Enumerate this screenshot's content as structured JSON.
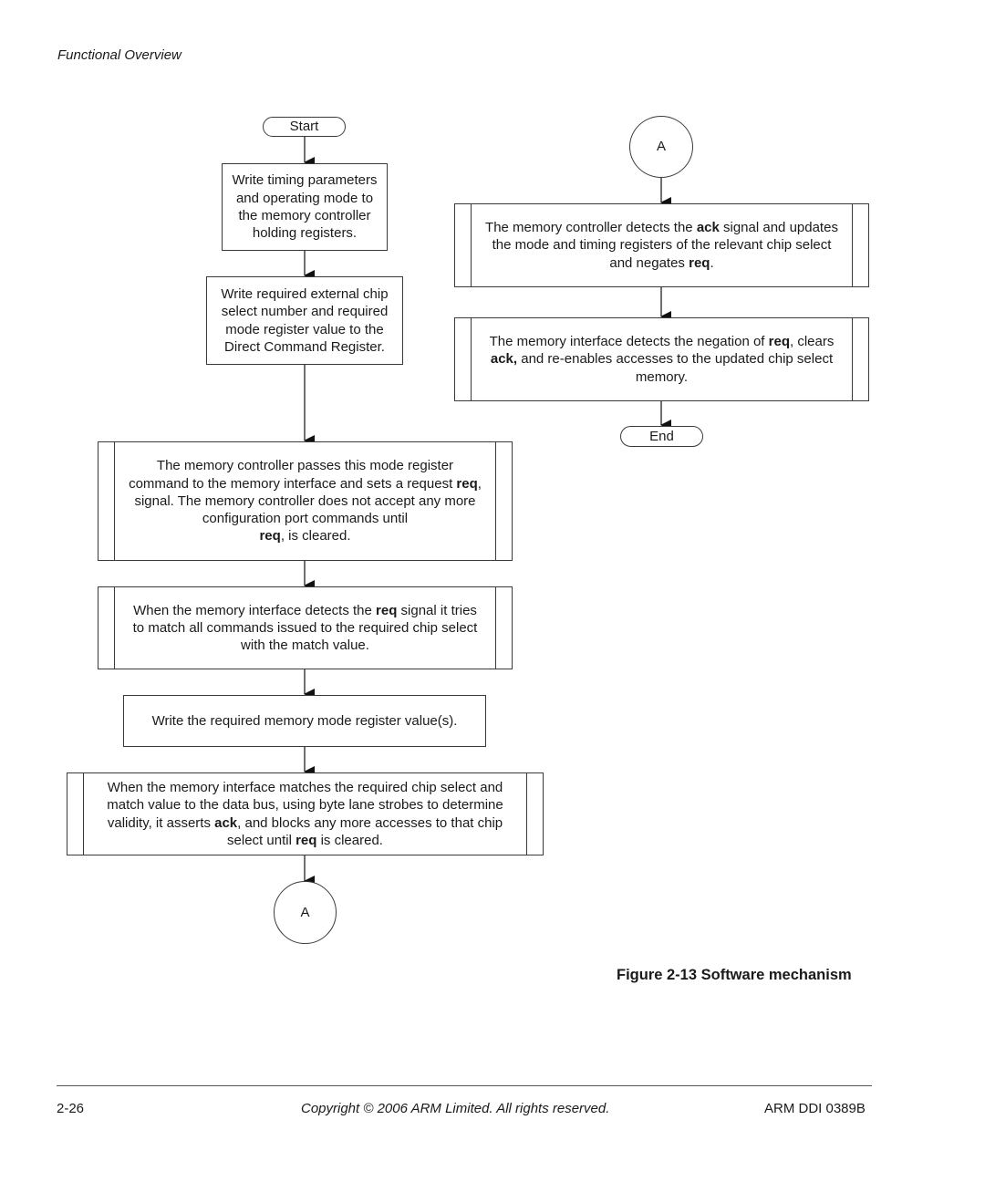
{
  "header": {
    "section": "Functional Overview"
  },
  "flowchart": {
    "start": "Start",
    "end": "End",
    "connector": "A",
    "left_steps": [
      {
        "id": "s1",
        "html": "Write timing parameters<br>and operating mode to<br>the memory controller<br>holding registers."
      },
      {
        "id": "s2",
        "html": "Write required external chip<br>select number and required<br>mode register value to the<br>Direct Command Register."
      },
      {
        "id": "s3",
        "html": "The memory controller passes this mode register<br>command to the memory interface and sets a request <b>req</b>,<br>signal. The memory controller does not accept any more<br>configuration port commands until<br><b>req</b>, is cleared."
      },
      {
        "id": "s4",
        "html": "When the memory interface detects the <b>req</b> signal it tries<br>to match all commands issued to the required chip select<br>with the match value."
      },
      {
        "id": "s5",
        "html": "Write the required memory mode register value(s)."
      },
      {
        "id": "s6",
        "html": "When the memory interface matches the required chip select and<br>match value to the data bus, using byte lane strobes to determine<br>validity, it asserts <b>ack</b>, and blocks any more accesses to that chip<br>select until <b>req</b> is cleared."
      }
    ],
    "right_steps": [
      {
        "id": "r1",
        "html": "The memory controller detects the <b>ack</b> signal and updates<br>the mode and timing registers of the relevant chip select<br>and negates <b>req</b>."
      },
      {
        "id": "r2",
        "html": "The memory interface detects the negation of <b>req</b>, clears<br><b>ack,</b> and re-enables accesses to the updated chip select<br>memory."
      }
    ]
  },
  "caption": "Figure 2-13 Software mechanism",
  "footer": {
    "page": "2-26",
    "copyright": "Copyright © 2006 ARM Limited. All rights reserved.",
    "doc_id": "ARM DDI 0389B"
  }
}
